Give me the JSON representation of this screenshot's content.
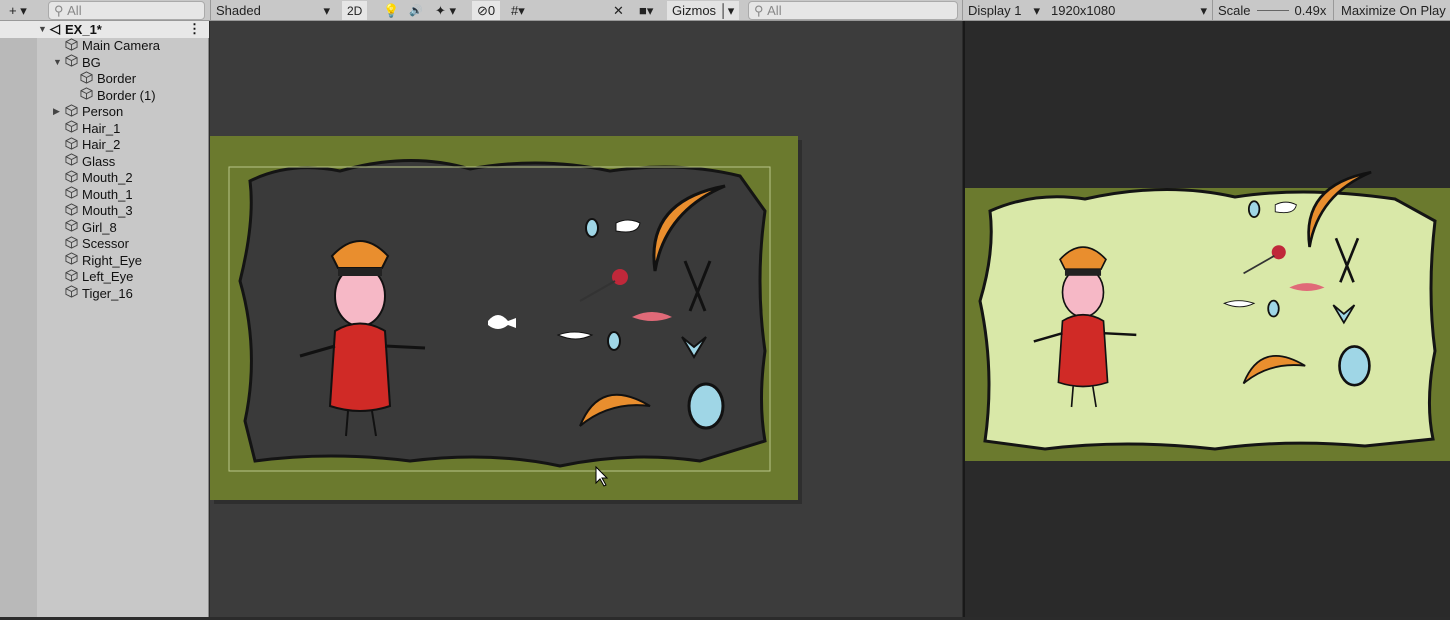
{
  "toolbar": {
    "add": "+ ▾",
    "hier_search": "All",
    "shading": "Shaded",
    "mode_2d": "2D",
    "hidden_count": "0",
    "gizmos": "Gizmos",
    "scene_search": "All",
    "display": "Display 1",
    "resolution": "1920x1080",
    "scale_label": "Scale",
    "scale_value": "0.49x",
    "maximize": "Maximize On Play"
  },
  "hierarchy": {
    "scene": "EX_1*",
    "items": [
      {
        "label": "Main Camera",
        "depth": 1
      },
      {
        "label": "BG",
        "depth": 1,
        "expanded": true
      },
      {
        "label": "Border",
        "depth": 2
      },
      {
        "label": "Border (1)",
        "depth": 2
      },
      {
        "label": "Person",
        "depth": 1,
        "collapsed": true
      },
      {
        "label": "Hair_1",
        "depth": 1
      },
      {
        "label": "Hair_2",
        "depth": 1
      },
      {
        "label": "Glass",
        "depth": 1
      },
      {
        "label": "Mouth_2",
        "depth": 1
      },
      {
        "label": "Mouth_1",
        "depth": 1
      },
      {
        "label": "Mouth_3",
        "depth": 1
      },
      {
        "label": "Girl_8",
        "depth": 1
      },
      {
        "label": "Scessor",
        "depth": 1
      },
      {
        "label": "Right_Eye",
        "depth": 1
      },
      {
        "label": "Left_Eye",
        "depth": 1
      },
      {
        "label": "Tiger_16",
        "depth": 1
      }
    ]
  },
  "colors": {
    "border_green": "#6b7a2e",
    "scene_bg": "#3a3a3a",
    "game_bg": "#d9e8a8"
  }
}
